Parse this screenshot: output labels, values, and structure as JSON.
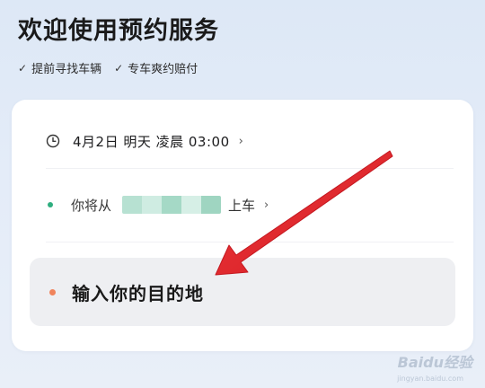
{
  "header": {
    "title": "欢迎使用预约服务",
    "features": [
      {
        "icon": "check-icon",
        "label": "提前寻找车辆"
      },
      {
        "icon": "check-icon",
        "label": "专车爽约赔付"
      }
    ]
  },
  "booking": {
    "time": {
      "icon": "clock-icon",
      "text": "4月2日 明天 凌晨 03:00",
      "chevron": "›"
    },
    "pickup": {
      "prefix": "你将从",
      "suffix": "上车",
      "chevron": "›",
      "dot_color": "#2fae7f"
    },
    "destination": {
      "placeholder": "输入你的目的地",
      "dot_color": "#f0845c"
    }
  },
  "annotation": {
    "arrow_color": "#e5232b"
  },
  "watermark": {
    "text": "Baidu经验",
    "sub": "jingyan.baidu.com"
  }
}
